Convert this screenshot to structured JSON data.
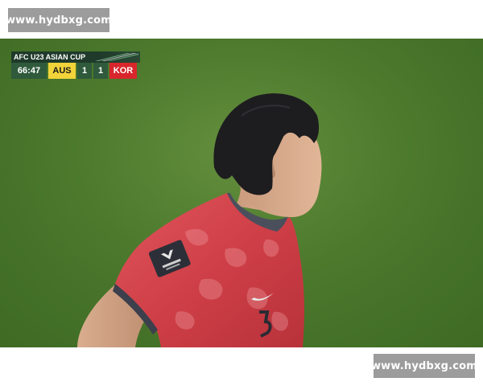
{
  "watermarks": {
    "top": "www.hydbxg.com",
    "bottom": "www.hydbxg.com"
  },
  "scoreboard": {
    "competition": "AFC U23 ASIAN CUP",
    "clock": "66:47",
    "home_team": "AUS",
    "home_score": "1",
    "away_score": "1",
    "away_team": "KOR",
    "colors": {
      "home": "#f2d43a",
      "away": "#d8262c",
      "panel": "#2f5a3c"
    }
  },
  "scene": {
    "subject": "player in red shirt",
    "pitch_color": "#4b7a2c",
    "shirt_color": "#d64a52",
    "badge_icon": "tournament-badge-icon"
  }
}
